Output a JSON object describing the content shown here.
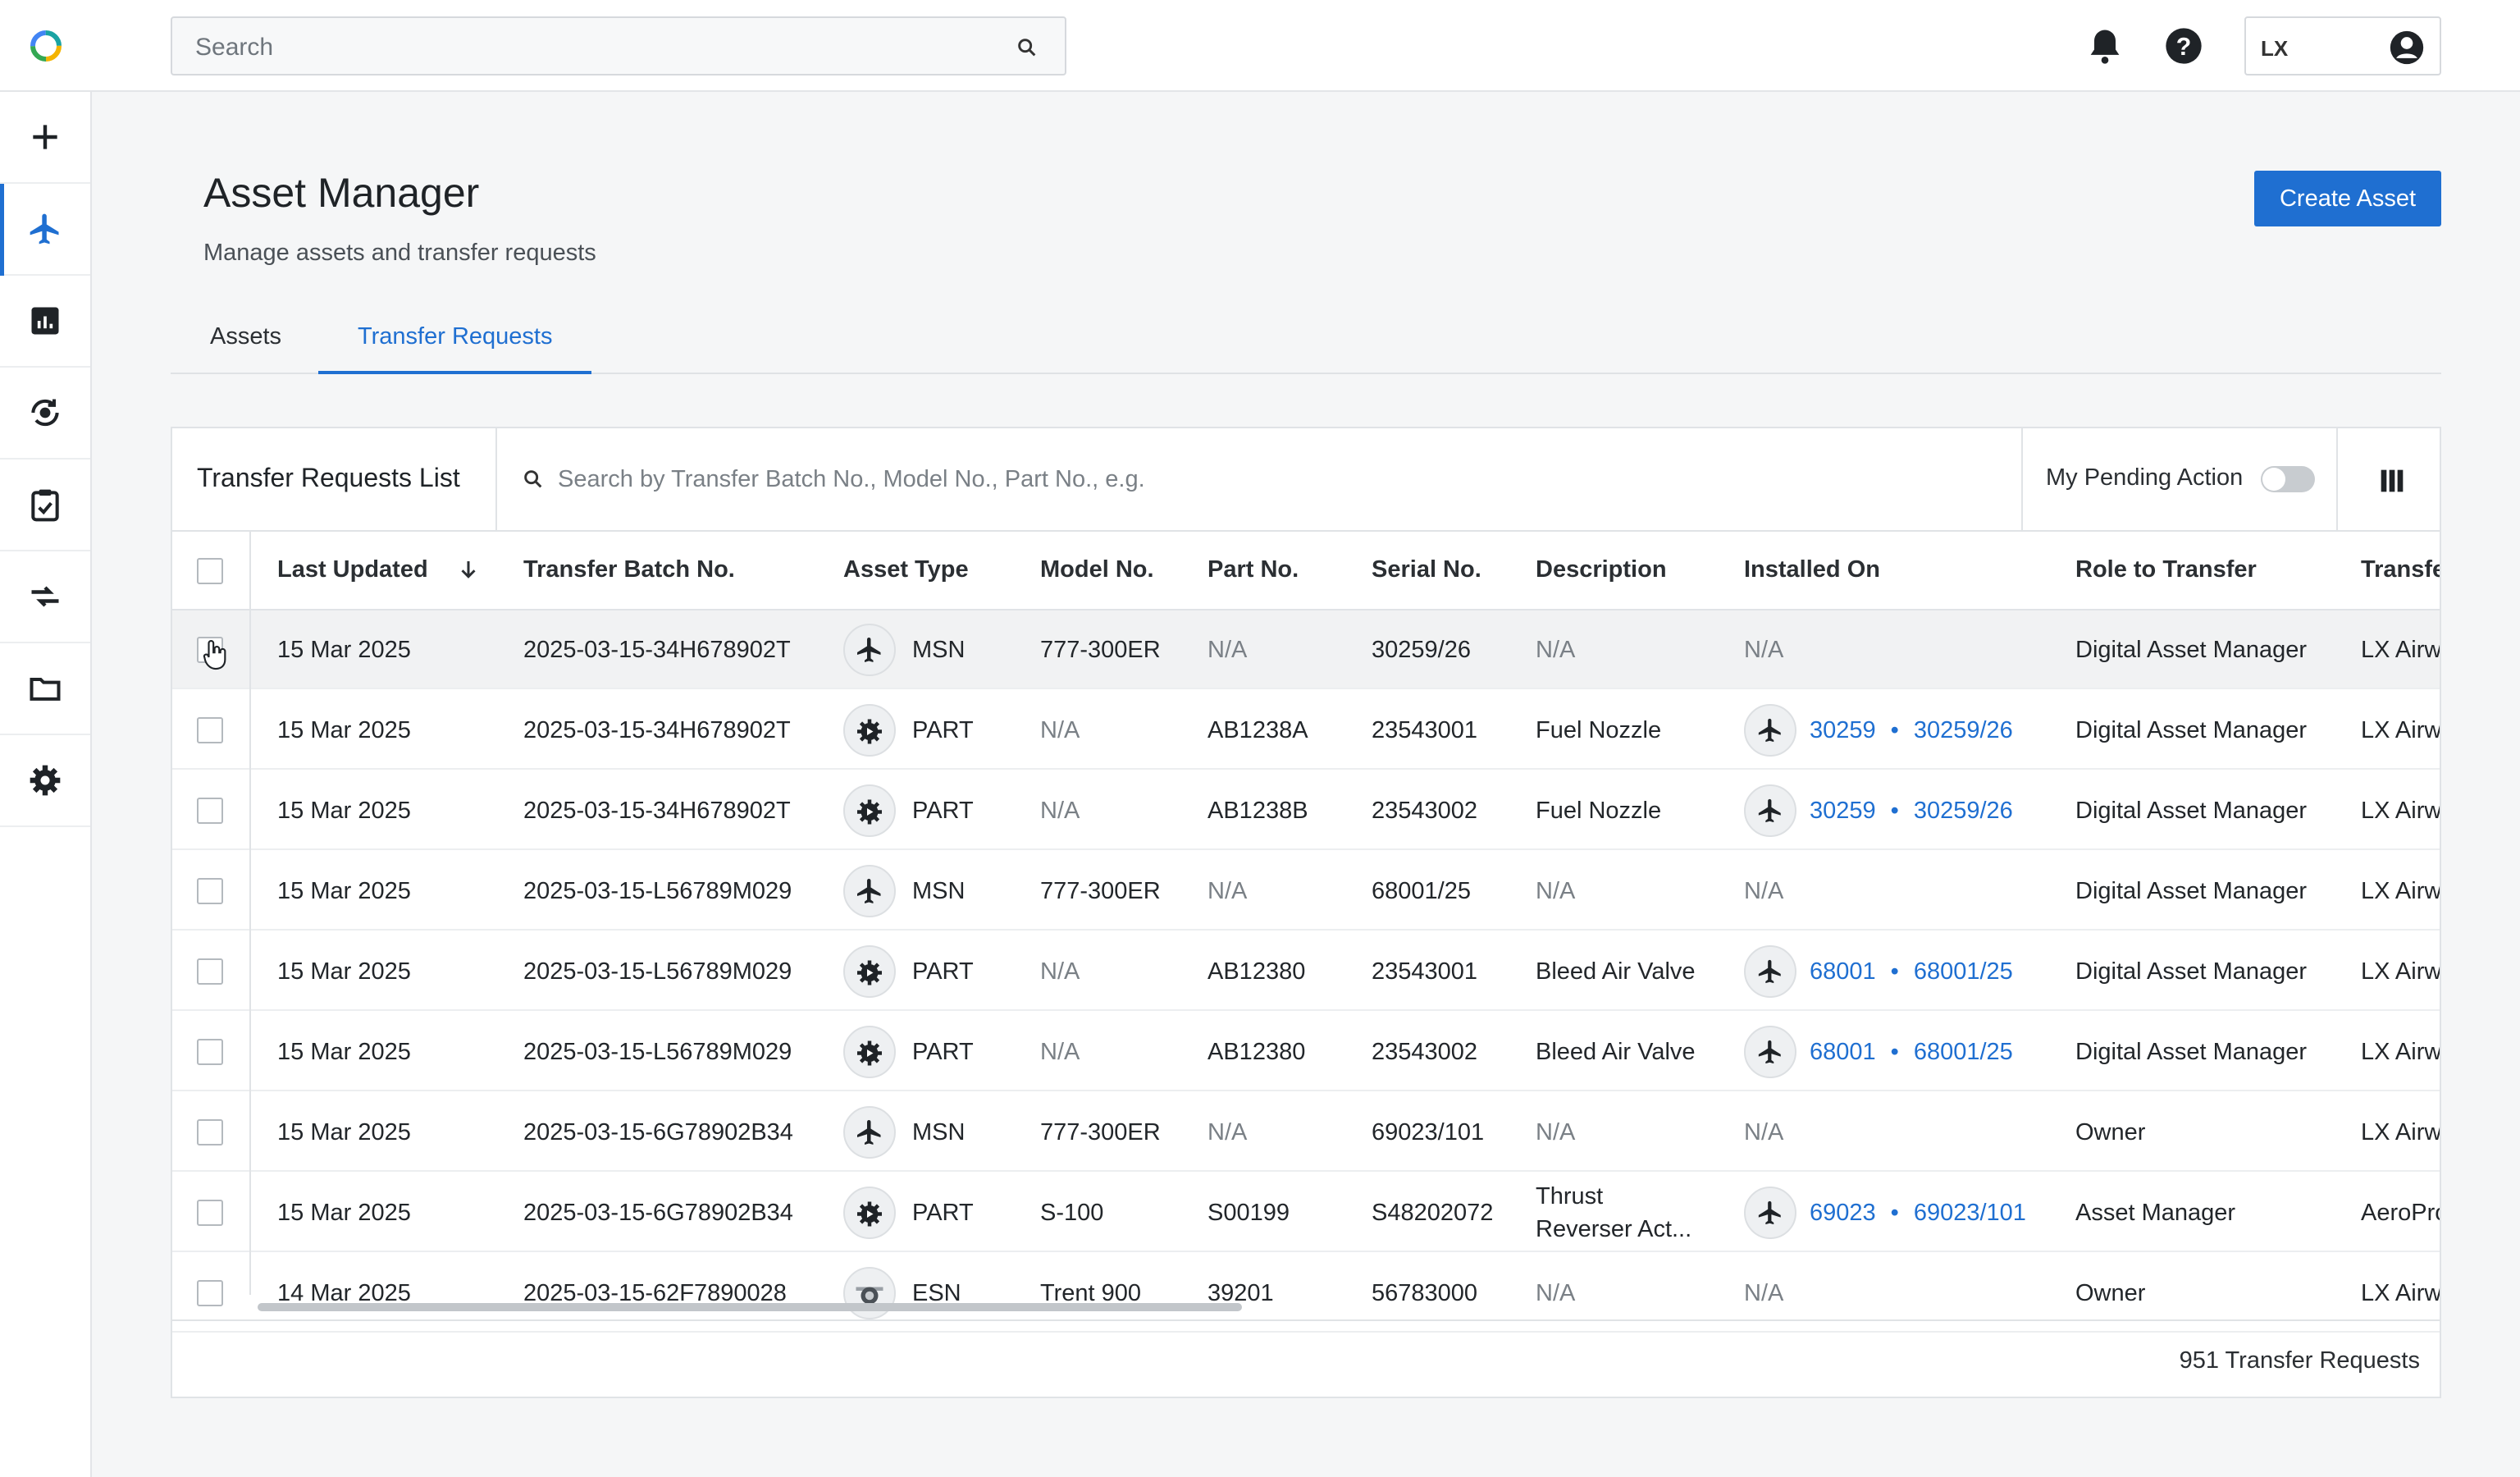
{
  "topbar": {
    "search_placeholder": "Search",
    "user_initials": "LX"
  },
  "sidebar": {
    "items": [
      {
        "icon": "plus-icon"
      },
      {
        "icon": "plane-icon",
        "active": true
      },
      {
        "icon": "chart-icon"
      },
      {
        "icon": "sync-icon"
      },
      {
        "icon": "clipboard-check-icon"
      },
      {
        "icon": "transfer-icon"
      },
      {
        "icon": "folder-icon"
      },
      {
        "icon": "gear-icon"
      }
    ]
  },
  "header": {
    "title": "Asset Manager",
    "subtitle": "Manage assets and transfer requests",
    "create_button": "Create Asset"
  },
  "tabs": [
    {
      "label": "Assets",
      "active": false
    },
    {
      "label": "Transfer Requests",
      "active": true
    }
  ],
  "table": {
    "title": "Transfer Requests List",
    "search_placeholder": "Search by Transfer Batch No., Model No., Part No., e.g.",
    "pending_label": "My Pending Action",
    "pending_on": false,
    "columns": [
      "Last Updated",
      "Transfer Batch No.",
      "Asset Type",
      "Model No.",
      "Part No.",
      "Serial No.",
      "Description",
      "Installed On",
      "Role to Transfer",
      "Transfe"
    ],
    "rows": [
      {
        "updated": "15 Mar 2025",
        "batch": "2025-03-15-34H678902T",
        "type": "MSN",
        "model": "777-300ER",
        "part": "N/A",
        "serial": "30259/26",
        "desc": "N/A",
        "inst_a": "",
        "inst_b": "",
        "inst_na": "N/A",
        "role": "Digital Asset Manager",
        "to": "LX Airw"
      },
      {
        "updated": "15 Mar 2025",
        "batch": "2025-03-15-34H678902T",
        "type": "PART",
        "model": "N/A",
        "part": "AB1238A",
        "serial": "23543001",
        "desc": "Fuel Nozzle",
        "inst_a": "30259",
        "inst_b": "30259/26",
        "inst_na": "",
        "role": "Digital Asset Manager",
        "to": "LX Airw"
      },
      {
        "updated": "15 Mar 2025",
        "batch": "2025-03-15-34H678902T",
        "type": "PART",
        "model": "N/A",
        "part": "AB1238B",
        "serial": "23543002",
        "desc": "Fuel Nozzle",
        "inst_a": "30259",
        "inst_b": "30259/26",
        "inst_na": "",
        "role": "Digital Asset Manager",
        "to": "LX Airw"
      },
      {
        "updated": "15 Mar 2025",
        "batch": "2025-03-15-L56789M029",
        "type": "MSN",
        "model": "777-300ER",
        "part": "N/A",
        "serial": "68001/25",
        "desc": "N/A",
        "inst_a": "",
        "inst_b": "",
        "inst_na": "N/A",
        "role": "Digital Asset Manager",
        "to": "LX Airw"
      },
      {
        "updated": "15 Mar 2025",
        "batch": "2025-03-15-L56789M029",
        "type": "PART",
        "model": "N/A",
        "part": "AB12380",
        "serial": "23543001",
        "desc": "Bleed Air Valve",
        "inst_a": "68001",
        "inst_b": "68001/25",
        "inst_na": "",
        "role": "Digital Asset Manager",
        "to": "LX Airw"
      },
      {
        "updated": "15 Mar 2025",
        "batch": "2025-03-15-L56789M029",
        "type": "PART",
        "model": "N/A",
        "part": "AB12380",
        "serial": "23543002",
        "desc": "Bleed Air Valve",
        "inst_a": "68001",
        "inst_b": "68001/25",
        "inst_na": "",
        "role": "Digital Asset Manager",
        "to": "LX Airw"
      },
      {
        "updated": "15 Mar 2025",
        "batch": "2025-03-15-6G78902B34",
        "type": "MSN",
        "model": "777-300ER",
        "part": "N/A",
        "serial": "69023/101",
        "desc": "N/A",
        "inst_a": "",
        "inst_b": "",
        "inst_na": "N/A",
        "role": "Owner",
        "to": "LX Airw"
      },
      {
        "updated": "15 Mar 2025",
        "batch": "2025-03-15-6G78902B34",
        "type": "PART",
        "model": "S-100",
        "part": "S00199",
        "serial": "S48202072",
        "desc": "Thrust Reverser Act...",
        "inst_a": "69023",
        "inst_b": "69023/101",
        "inst_na": "",
        "role": "Asset Manager",
        "to": "AeroPro"
      },
      {
        "updated": "14 Mar 2025",
        "batch": "2025-03-15-62F7890028",
        "type": "ESN",
        "model": "Trent 900",
        "part": "39201",
        "serial": "56783000",
        "desc": "N/A",
        "inst_a": "",
        "inst_b": "",
        "inst_na": "N/A",
        "role": "Owner",
        "to": "LX Airw"
      }
    ],
    "footer_count": "951 Transfer Requests"
  },
  "colors": {
    "accent": "#1f6fd1",
    "muted_text": "#7a8086"
  }
}
